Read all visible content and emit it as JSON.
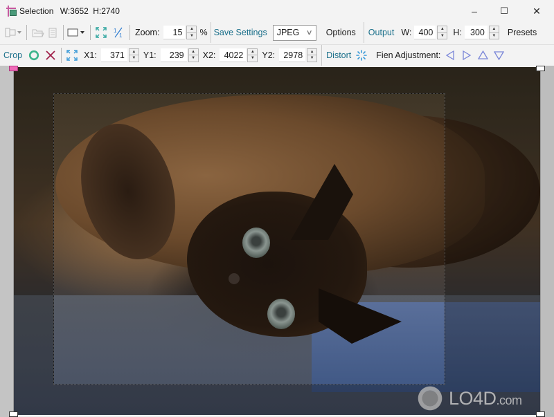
{
  "window": {
    "title": "Selection",
    "width_readout": "W:3652",
    "height_readout": "H:2740",
    "controls": {
      "minimize": "–",
      "maximize": "☐",
      "close": "✕"
    }
  },
  "toolbar1": {
    "icons": {
      "align": "align-dropdown-icon",
      "open": "folder-open-icon",
      "document": "document-icon",
      "frame": "frame-dropdown-icon",
      "fit": "fit-to-window-icon",
      "actual_size": "actual-size-icon"
    },
    "actual_size_glyph": "⅟₁",
    "zoom_label": "Zoom:",
    "zoom_value": "15",
    "zoom_unit": "%",
    "save_settings": "Save Settings",
    "format_selected": "JPEG",
    "options": "Options",
    "output_label": "Output",
    "w_label": "W:",
    "w_value": "400",
    "h_label": "H:",
    "h_value": "300",
    "presets": "Presets"
  },
  "toolbar2": {
    "crop_label": "Crop",
    "x1_label": "X1:",
    "x1_value": "371",
    "y1_label": "Y1:",
    "y1_value": "239",
    "x2_label": "X2:",
    "x2_value": "4022",
    "y2_label": "Y2:",
    "y2_value": "2978",
    "distort_label": "Distort",
    "fine_adjustment_label": "Fien Adjustment:",
    "colors": {
      "confirm": "#3cb48c",
      "cancel": "#a0204a",
      "accent_blue": "#3a9ad8",
      "arrow": "#7a86d8",
      "link": "#1a6f8a"
    }
  },
  "watermark": {
    "brand": "LO4D",
    "suffix": ".com"
  }
}
